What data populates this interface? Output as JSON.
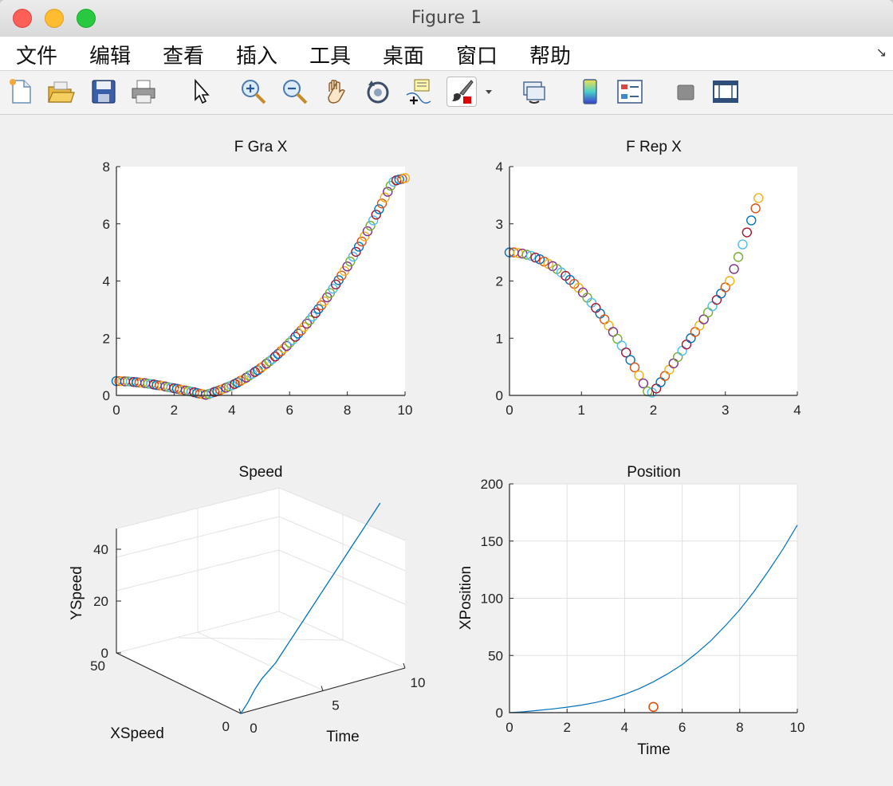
{
  "window": {
    "title": "Figure 1"
  },
  "menu": [
    "文件",
    "编辑",
    "查看",
    "插入",
    "工具",
    "桌面",
    "窗口",
    "帮助"
  ],
  "menu_corner_icon": "dock-arrow-icon",
  "toolbar": [
    {
      "name": "new-figure-button",
      "icon": "new-file-icon"
    },
    {
      "name": "open-file-button",
      "icon": "folder-icon"
    },
    {
      "name": "save-button",
      "icon": "floppy-icon"
    },
    {
      "name": "print-button",
      "icon": "printer-icon"
    },
    {
      "name": "edit-plot-button",
      "icon": "pointer-icon"
    },
    {
      "name": "zoom-in-button",
      "icon": "zoom-in-icon"
    },
    {
      "name": "zoom-out-button",
      "icon": "zoom-out-icon"
    },
    {
      "name": "pan-button",
      "icon": "hand-icon"
    },
    {
      "name": "rotate-3d-button",
      "icon": "rotate-icon"
    },
    {
      "name": "data-cursor-button",
      "icon": "data-tip-icon"
    },
    {
      "name": "brush-button",
      "icon": "brush-icon"
    },
    {
      "name": "link-plot-button",
      "icon": "link-plot-icon"
    },
    {
      "name": "colorbar-button",
      "icon": "colorbar-icon"
    },
    {
      "name": "legend-button",
      "icon": "legend-icon"
    },
    {
      "name": "hide-plot-tools-button",
      "icon": "hide-tools-icon"
    },
    {
      "name": "show-plot-tools-button",
      "icon": "dock-tools-icon"
    }
  ],
  "chart_data": [
    {
      "type": "scatter",
      "title": "F Gra X",
      "xlabel": "",
      "ylabel": "",
      "xlim": [
        0,
        10
      ],
      "ylim": [
        0,
        8
      ],
      "xticks": [
        0,
        2,
        4,
        6,
        8,
        10
      ],
      "yticks": [
        0,
        2,
        4,
        6,
        8
      ],
      "grid": false,
      "marker": "circle-open",
      "x": [
        0.0,
        0.1,
        0.2,
        0.3,
        0.4,
        0.5,
        0.6,
        0.7,
        0.8,
        0.9,
        1.0,
        1.1,
        1.2,
        1.3,
        1.4,
        1.5,
        1.6,
        1.7,
        1.8,
        1.9,
        2.0,
        2.1,
        2.2,
        2.3,
        2.4,
        2.5,
        2.6,
        2.7,
        2.8,
        2.9,
        3.0,
        3.1,
        3.2,
        3.3,
        3.4,
        3.5,
        3.6,
        3.7,
        3.8,
        3.9,
        4.0,
        4.1,
        4.2,
        4.3,
        4.4,
        4.5,
        4.6,
        4.7,
        4.8,
        4.9,
        5.0,
        5.1,
        5.2,
        5.3,
        5.4,
        5.5,
        5.6,
        5.7,
        5.8,
        5.9,
        6.0,
        6.1,
        6.2,
        6.3,
        6.4,
        6.5,
        6.6,
        6.7,
        6.8,
        6.9,
        7.0,
        7.1,
        7.2,
        7.3,
        7.4,
        7.5,
        7.6,
        7.7,
        7.8,
        7.9,
        8.0,
        8.1,
        8.2,
        8.3,
        8.4,
        8.5,
        8.6,
        8.7,
        8.8,
        8.9,
        9.0,
        9.1,
        9.2,
        9.3,
        9.4,
        9.5,
        9.6,
        9.7,
        9.8,
        9.9,
        10.0
      ],
      "y": [
        0.5,
        0.5,
        0.5,
        0.49,
        0.49,
        0.48,
        0.47,
        0.46,
        0.45,
        0.44,
        0.43,
        0.41,
        0.4,
        0.38,
        0.36,
        0.35,
        0.33,
        0.31,
        0.29,
        0.27,
        0.25,
        0.23,
        0.21,
        0.19,
        0.17,
        0.15,
        0.13,
        0.11,
        0.08,
        0.06,
        0.04,
        0.02,
        0.05,
        0.08,
        0.12,
        0.15,
        0.19,
        0.23,
        0.27,
        0.31,
        0.35,
        0.4,
        0.45,
        0.51,
        0.56,
        0.62,
        0.69,
        0.75,
        0.82,
        0.88,
        0.96,
        1.03,
        1.11,
        1.19,
        1.27,
        1.36,
        1.45,
        1.54,
        1.64,
        1.73,
        1.84,
        1.94,
        2.05,
        2.16,
        2.27,
        2.39,
        2.51,
        2.63,
        2.76,
        2.88,
        3.02,
        3.15,
        3.29,
        3.43,
        3.58,
        3.73,
        3.88,
        4.03,
        4.19,
        4.35,
        4.51,
        4.68,
        4.85,
        5.02,
        5.2,
        5.38,
        5.56,
        5.74,
        5.93,
        6.12,
        6.32,
        6.51,
        6.71,
        6.92,
        7.12,
        7.33,
        7.47,
        7.52,
        7.55,
        7.57,
        7.6
      ]
    },
    {
      "type": "scatter",
      "title": "F Rep X",
      "xlabel": "",
      "ylabel": "",
      "xlim": [
        0,
        4
      ],
      "ylim": [
        0,
        4
      ],
      "xticks": [
        0,
        1,
        2,
        3,
        4
      ],
      "yticks": [
        0,
        1,
        2,
        3,
        4
      ],
      "grid": false,
      "marker": "circle-open",
      "x": [
        0.0,
        0.06,
        0.12,
        0.18,
        0.24,
        0.3,
        0.36,
        0.42,
        0.48,
        0.54,
        0.6,
        0.66,
        0.72,
        0.78,
        0.84,
        0.9,
        0.96,
        1.02,
        1.08,
        1.14,
        1.2,
        1.26,
        1.32,
        1.38,
        1.44,
        1.5,
        1.56,
        1.62,
        1.68,
        1.74,
        1.8,
        1.86,
        1.92,
        1.98,
        2.04,
        2.1,
        2.16,
        2.22,
        2.28,
        2.34,
        2.4,
        2.46,
        2.52,
        2.58,
        2.64,
        2.7,
        2.76,
        2.82,
        2.88,
        2.94,
        3.0,
        3.06,
        3.12,
        3.18,
        3.24,
        3.3,
        3.36,
        3.42,
        3.46
      ],
      "y": [
        2.5,
        2.5,
        2.49,
        2.48,
        2.46,
        2.44,
        2.41,
        2.38,
        2.34,
        2.3,
        2.26,
        2.21,
        2.15,
        2.09,
        2.02,
        1.95,
        1.88,
        1.8,
        1.71,
        1.62,
        1.53,
        1.43,
        1.33,
        1.22,
        1.11,
        0.99,
        0.87,
        0.75,
        0.62,
        0.49,
        0.35,
        0.21,
        0.07,
        0.05,
        0.12,
        0.23,
        0.34,
        0.45,
        0.56,
        0.67,
        0.78,
        0.89,
        1.0,
        1.11,
        1.22,
        1.33,
        1.45,
        1.56,
        1.67,
        1.78,
        1.89,
        2.0,
        2.21,
        2.42,
        2.64,
        2.85,
        3.06,
        3.27,
        3.45
      ]
    },
    {
      "type": "line",
      "title": "Speed",
      "xlabel": "Time",
      "ylabel": "YSpeed",
      "zlabel_side": "XSpeed",
      "time_ticks": [
        "0",
        "5",
        "10"
      ],
      "xspeed_ticks": [
        "0",
        "50"
      ],
      "yspeed_ticks": [
        "0",
        "20",
        "40"
      ],
      "time": [
        0,
        0.5,
        1,
        1.5,
        2,
        2.5,
        3,
        3.5,
        4,
        4.5,
        5,
        5.5,
        6,
        6.5,
        7,
        7.5,
        8,
        8.5,
        9,
        9.5,
        10
      ],
      "xspeed": [
        0,
        0.5,
        1.0,
        1.5,
        2.0,
        2.5,
        3.0,
        3.5,
        4.0,
        4.5,
        5.0,
        5.5,
        6.0,
        6.5,
        7.0,
        7.5,
        8.0,
        8.5,
        9.0,
        9.5,
        10.0
      ],
      "yspeed": [
        0,
        3,
        7,
        10,
        12,
        14,
        17,
        20,
        23,
        26,
        29,
        32,
        35,
        38,
        41,
        44,
        47,
        50,
        53,
        56,
        59
      ]
    },
    {
      "type": "line",
      "title": "Position",
      "xlabel": "Time",
      "ylabel": "XPosition",
      "xlim": [
        0,
        10
      ],
      "ylim": [
        0,
        200
      ],
      "xticks": [
        0,
        2,
        4,
        6,
        8,
        10
      ],
      "yticks": [
        0,
        50,
        100,
        150,
        200
      ],
      "grid": true,
      "series": [
        {
          "x": [
            0,
            0.5,
            1,
            1.5,
            2,
            2.5,
            3,
            3.5,
            4,
            4.5,
            5,
            5.5,
            6,
            6.5,
            7,
            7.5,
            8,
            8.5,
            9,
            9.5,
            10
          ],
          "y": [
            0,
            0.8,
            2,
            3.3,
            4.8,
            6.6,
            8.9,
            12,
            16,
            21,
            27,
            34,
            42,
            52,
            63,
            76,
            90,
            106,
            124,
            143,
            164
          ],
          "color": "#0072BD"
        }
      ],
      "points": [
        {
          "x": 5,
          "y": 5,
          "color": "#D95319"
        }
      ]
    }
  ],
  "colors": [
    "#0072BD",
    "#D95319",
    "#EDB120",
    "#7E2F8E",
    "#77AC30",
    "#4DBEEE",
    "#A2142F"
  ]
}
